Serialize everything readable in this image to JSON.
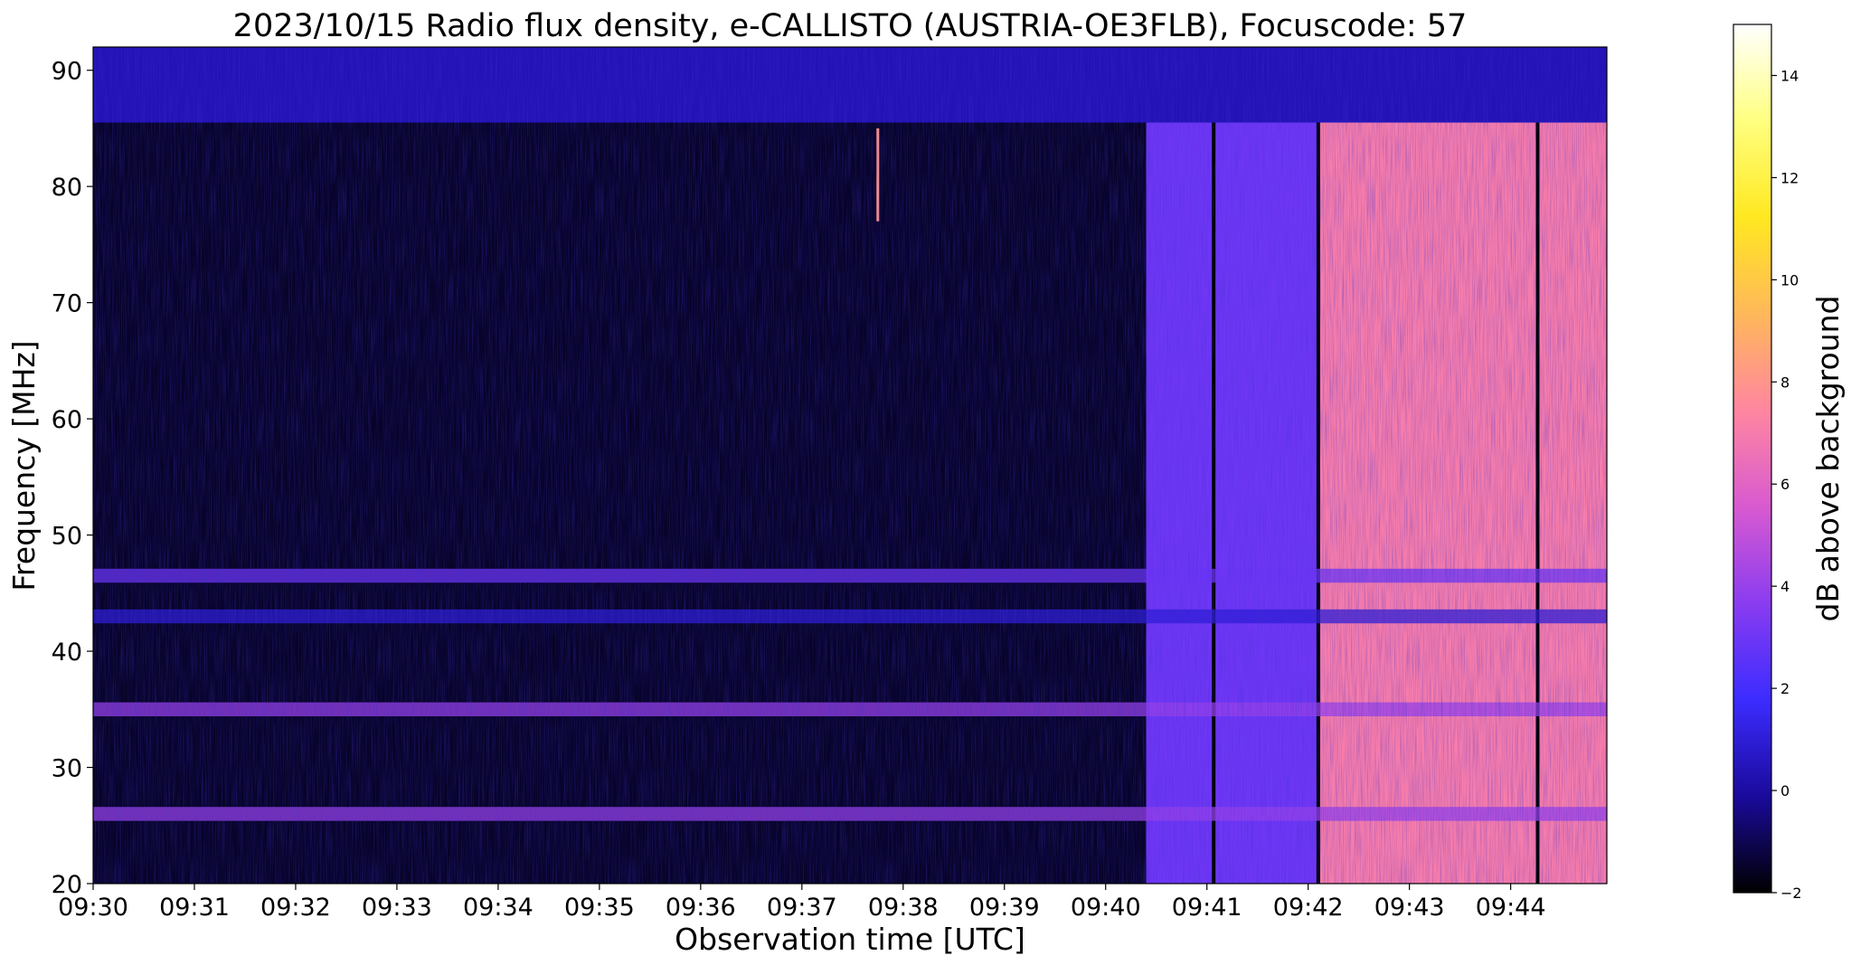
{
  "chart_data": {
    "type": "heatmap",
    "title": "2023/10/15  Radio flux density, e-CALLISTO (AUSTRIA-OE3FLB), Focuscode: 57",
    "xlabel": "Observation time [UTC]",
    "ylabel": "Frequency [MHz]",
    "x_ticks": [
      "09:30",
      "09:31",
      "09:32",
      "09:33",
      "09:34",
      "09:35",
      "09:36",
      "09:37",
      "09:38",
      "09:39",
      "09:40",
      "09:41",
      "09:42",
      "09:43",
      "09:44"
    ],
    "xlim": [
      "09:30:00",
      "09:44:57"
    ],
    "y_ticks": [
      20,
      30,
      40,
      50,
      60,
      70,
      80,
      90
    ],
    "ylim": [
      20,
      92
    ],
    "colorbar": {
      "label": "dB above background",
      "ticks": [
        -2,
        0,
        2,
        4,
        6,
        8,
        10,
        12,
        14
      ],
      "range": [
        -2,
        15
      ],
      "colormap": "gnuplot2",
      "stops": [
        "#000000",
        "#1a0a9c",
        "#3c2cff",
        "#8a3cf0",
        "#d85ad0",
        "#ff86a0",
        "#ffb85a",
        "#ffe820",
        "#ffff80",
        "#ffffff"
      ]
    },
    "features": [
      {
        "type": "quiet-background",
        "from": "09:30:00",
        "to": "09:40:24",
        "level": -1.5
      },
      {
        "type": "broadband-emission",
        "from": "09:40:24",
        "to": "09:42:06",
        "level": 3
      },
      {
        "type": "broadband-emission",
        "from": "09:42:06",
        "to": "09:44:57",
        "level": 7
      },
      {
        "type": "data-gap",
        "at": "09:41:04"
      },
      {
        "type": "data-gap",
        "at": "09:42:06"
      },
      {
        "type": "data-gap",
        "at": "09:44:16"
      },
      {
        "type": "spike",
        "at": "09:37:45",
        "freq": [
          77,
          85
        ],
        "level": 8
      },
      {
        "type": "interference-band",
        "freq": 35,
        "level": 4
      },
      {
        "type": "interference-band",
        "freq": 46.5,
        "level": 3
      },
      {
        "type": "interference-band",
        "freq": 43,
        "level": 1
      },
      {
        "type": "interference-band",
        "freq": 26,
        "level": 4
      }
    ]
  }
}
